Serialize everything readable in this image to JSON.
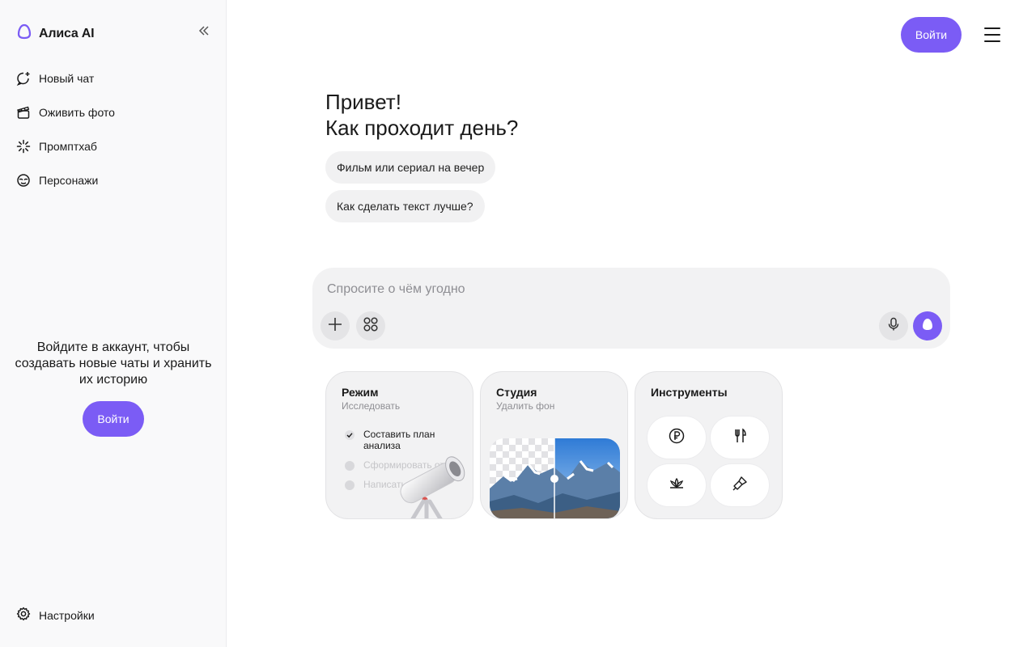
{
  "brand": {
    "name": "Алиса AI"
  },
  "sidebar": {
    "items": [
      {
        "label": "Новый чат",
        "icon": "new-chat-icon"
      },
      {
        "label": "Оживить фото",
        "icon": "clapperboard-icon"
      },
      {
        "label": "Промптхаб",
        "icon": "sparkle-icon"
      },
      {
        "label": "Персонажи",
        "icon": "mask-icon"
      }
    ],
    "login_text": "Войдите в аккаунт, чтобы создавать новые чаты и хранить их историю",
    "login_button": "Войти",
    "settings_label": "Настройки"
  },
  "header": {
    "login_button": "Войти"
  },
  "greeting": {
    "line1": "Привет!",
    "line2": "Как проходит день?"
  },
  "suggestions": [
    "Фильм или сериал на вечер",
    "Как сделать текст лучше?"
  ],
  "input": {
    "placeholder": "Спросите о чём угодно"
  },
  "cards": {
    "mode": {
      "title": "Режим",
      "subtitle": "Исследовать",
      "steps": [
        "Составить план анализа",
        "Сформировать отчёт",
        "Написать выводы"
      ]
    },
    "studio": {
      "title": "Студия",
      "subtitle": "Удалить фон"
    },
    "tools": {
      "title": "Инструменты",
      "buttons": [
        "ruble-coin-icon",
        "fork-knife-icon",
        "lotus-icon",
        "brush-icon"
      ]
    }
  },
  "colors": {
    "accent": "#7b5cf5",
    "sidebar_bg": "#f9f9fa",
    "input_bg": "#f2f2f3"
  }
}
